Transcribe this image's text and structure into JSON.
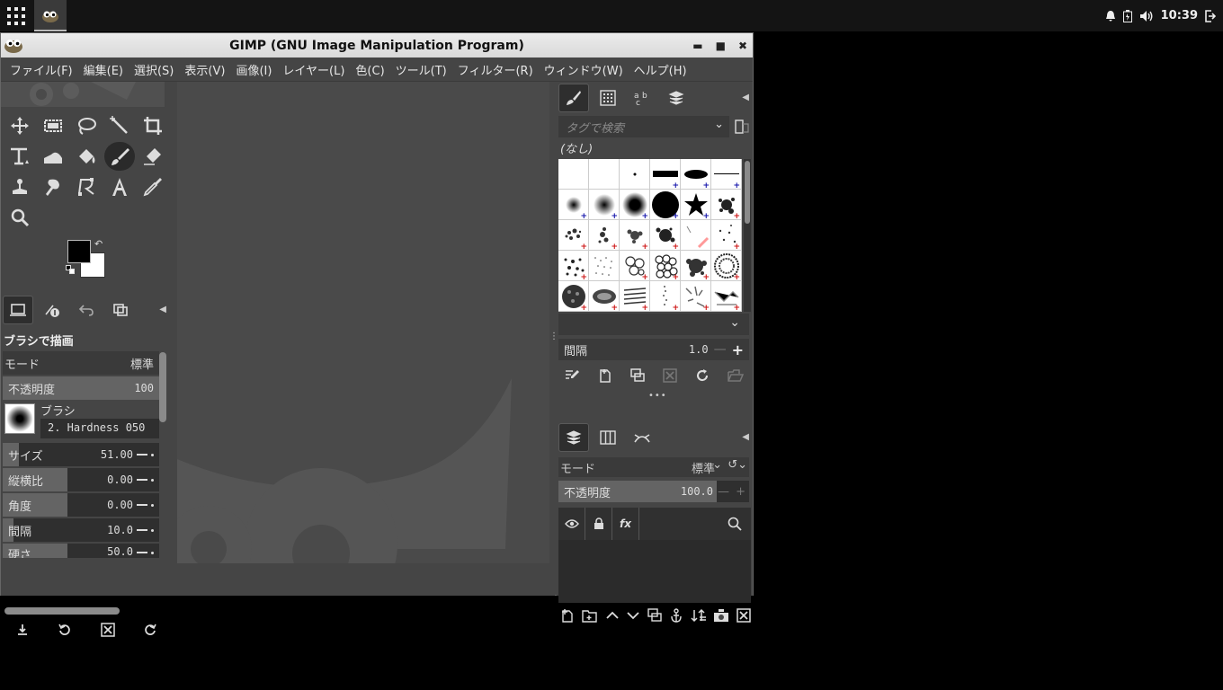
{
  "taskbar": {
    "clock": "10:39",
    "app_icon": "gimp-icon",
    "tray_icons": [
      "bell-icon",
      "battery-icon",
      "volume-icon",
      "logout-icon"
    ]
  },
  "window": {
    "title": "GIMP (GNU Image Manipulation Program)",
    "controls": [
      "minimize",
      "maximize",
      "close"
    ]
  },
  "menu": {
    "items": [
      "ファイル(F)",
      "編集(E)",
      "選択(S)",
      "表示(V)",
      "画像(I)",
      "レイヤー(L)",
      "色(C)",
      "ツール(T)",
      "フィルター(R)",
      "ウィンドウ(W)",
      "ヘルプ(H)"
    ]
  },
  "toolbox": {
    "tools": [
      "move-tool",
      "rect-select-tool",
      "lasso-tool",
      "fuzzy-select-tool",
      "crop-tool",
      "transform-tool",
      "warp-tool",
      "bucket-fill-tool",
      "paintbrush-tool",
      "eraser-tool",
      "clone-tool",
      "smudge-tool",
      "paths-tool",
      "text-tool",
      "color-picker-tool",
      "zoom-tool"
    ],
    "active_tool": "paintbrush-tool",
    "fg_color": "#000000",
    "bg_color": "#ffffff"
  },
  "tool_options": {
    "title": "ブラシで描画",
    "mode_label": "モード",
    "mode_value": "標準",
    "opacity_label": "不透明度",
    "opacity_value": "100",
    "brush_label": "ブラシ",
    "brush_name": "2. Hardness 050",
    "sliders": [
      {
        "label": "サイズ",
        "value": "51.00"
      },
      {
        "label": "縦横比",
        "value": "0.00"
      },
      {
        "label": "角度",
        "value": "0.00"
      },
      {
        "label": "間隔",
        "value": "10.0"
      },
      {
        "label": "硬さ",
        "value": "50.0"
      }
    ]
  },
  "brushes_panel": {
    "tag_search_placeholder": "タグで検索",
    "tag_filter": "(なし)",
    "spacing_label": "間隔",
    "spacing_value": "1.0"
  },
  "layers_panel": {
    "mode_label": "モード",
    "mode_value": "標準",
    "opacity_label": "不透明度",
    "opacity_value": "100.0",
    "fx_label": "fx"
  },
  "colors": {
    "window_bg": "#454545",
    "canvas_bg": "#4a4a4a",
    "panel_dark": "#2b2b2b",
    "titlebar": "#e3e3e3"
  }
}
